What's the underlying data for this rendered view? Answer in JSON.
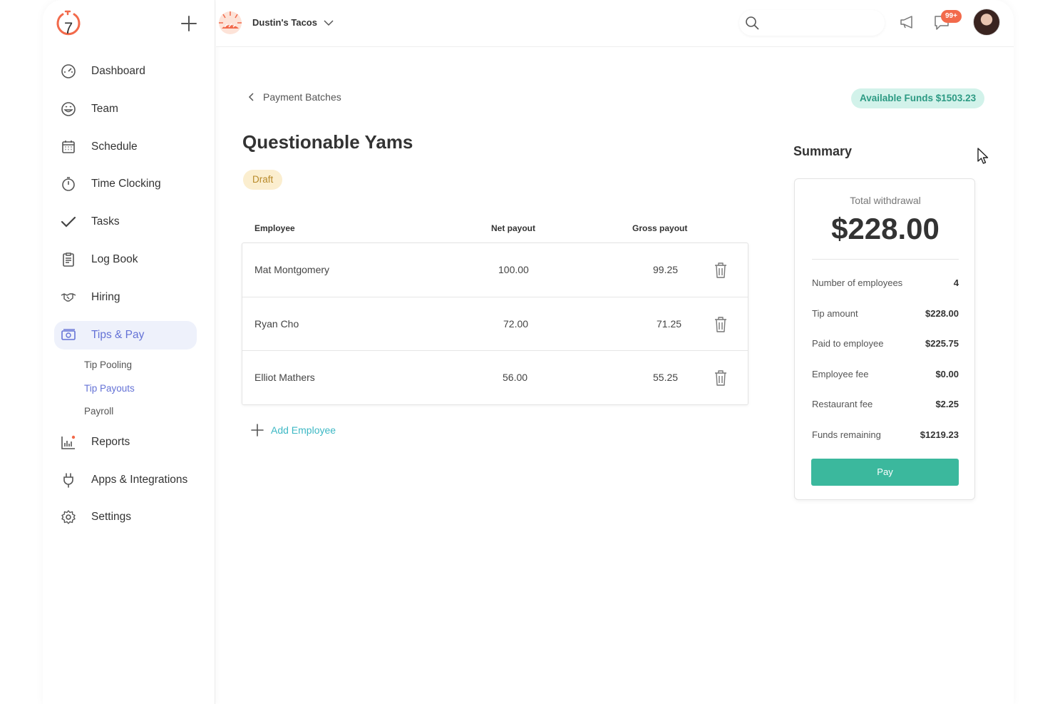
{
  "sidebar": {
    "logo_text": "7",
    "items": [
      {
        "label": "Dashboard",
        "icon": "dashboard-icon"
      },
      {
        "label": "Team",
        "icon": "smiley-icon"
      },
      {
        "label": "Schedule",
        "icon": "calendar-icon"
      },
      {
        "label": "Time Clocking",
        "icon": "stopwatch-icon"
      },
      {
        "label": "Tasks",
        "icon": "checkmark-icon"
      },
      {
        "label": "Log Book",
        "icon": "clipboard-icon"
      },
      {
        "label": "Hiring",
        "icon": "handshake-icon"
      },
      {
        "label": "Tips & Pay",
        "icon": "cash-icon",
        "active": true
      },
      {
        "label": "Reports",
        "icon": "bar-chart-icon"
      },
      {
        "label": "Apps & Integrations",
        "icon": "plug-icon"
      },
      {
        "label": "Settings",
        "icon": "gear-icon"
      }
    ],
    "subitems": [
      {
        "label": "Tip Pooling"
      },
      {
        "label": "Tip Payouts",
        "active": true
      },
      {
        "label": "Payroll"
      }
    ]
  },
  "topbar": {
    "restaurant_name": "Dustin's Tacos",
    "notifications_badge": "99+"
  },
  "main": {
    "back_label": "Payment Batches",
    "available_funds": "Available Funds $1503.23",
    "title": "Questionable Yams",
    "status": "Draft",
    "columns": {
      "employee": "Employee",
      "net": "Net payout",
      "gross": "Gross payout"
    },
    "rows": [
      {
        "employee": "Mat Montgomery",
        "net": "100.00",
        "gross": "99.25"
      },
      {
        "employee": "Ryan Cho",
        "net": "72.00",
        "gross": "71.25"
      },
      {
        "employee": "Elliot Mathers",
        "net": "56.00",
        "gross": "55.25"
      }
    ],
    "add_employee": "Add Employee"
  },
  "summary": {
    "title": "Summary",
    "total_label": "Total withdrawal",
    "total_amount": "$228.00",
    "rows": [
      {
        "label": "Number of employees",
        "value": "4"
      },
      {
        "label": "Tip amount",
        "value": "$228.00"
      },
      {
        "label": "Paid to employee",
        "value": "$225.75"
      },
      {
        "label": "Employee fee",
        "value": "$0.00"
      },
      {
        "label": "Restaurant fee",
        "value": "$2.25"
      },
      {
        "label": "Funds remaining",
        "value": "$1219.23"
      }
    ],
    "pay_label": "Pay"
  },
  "colors": {
    "accent": "#6472d6",
    "teal": "#3bb89d",
    "brand_orange": "#f26a4b"
  }
}
